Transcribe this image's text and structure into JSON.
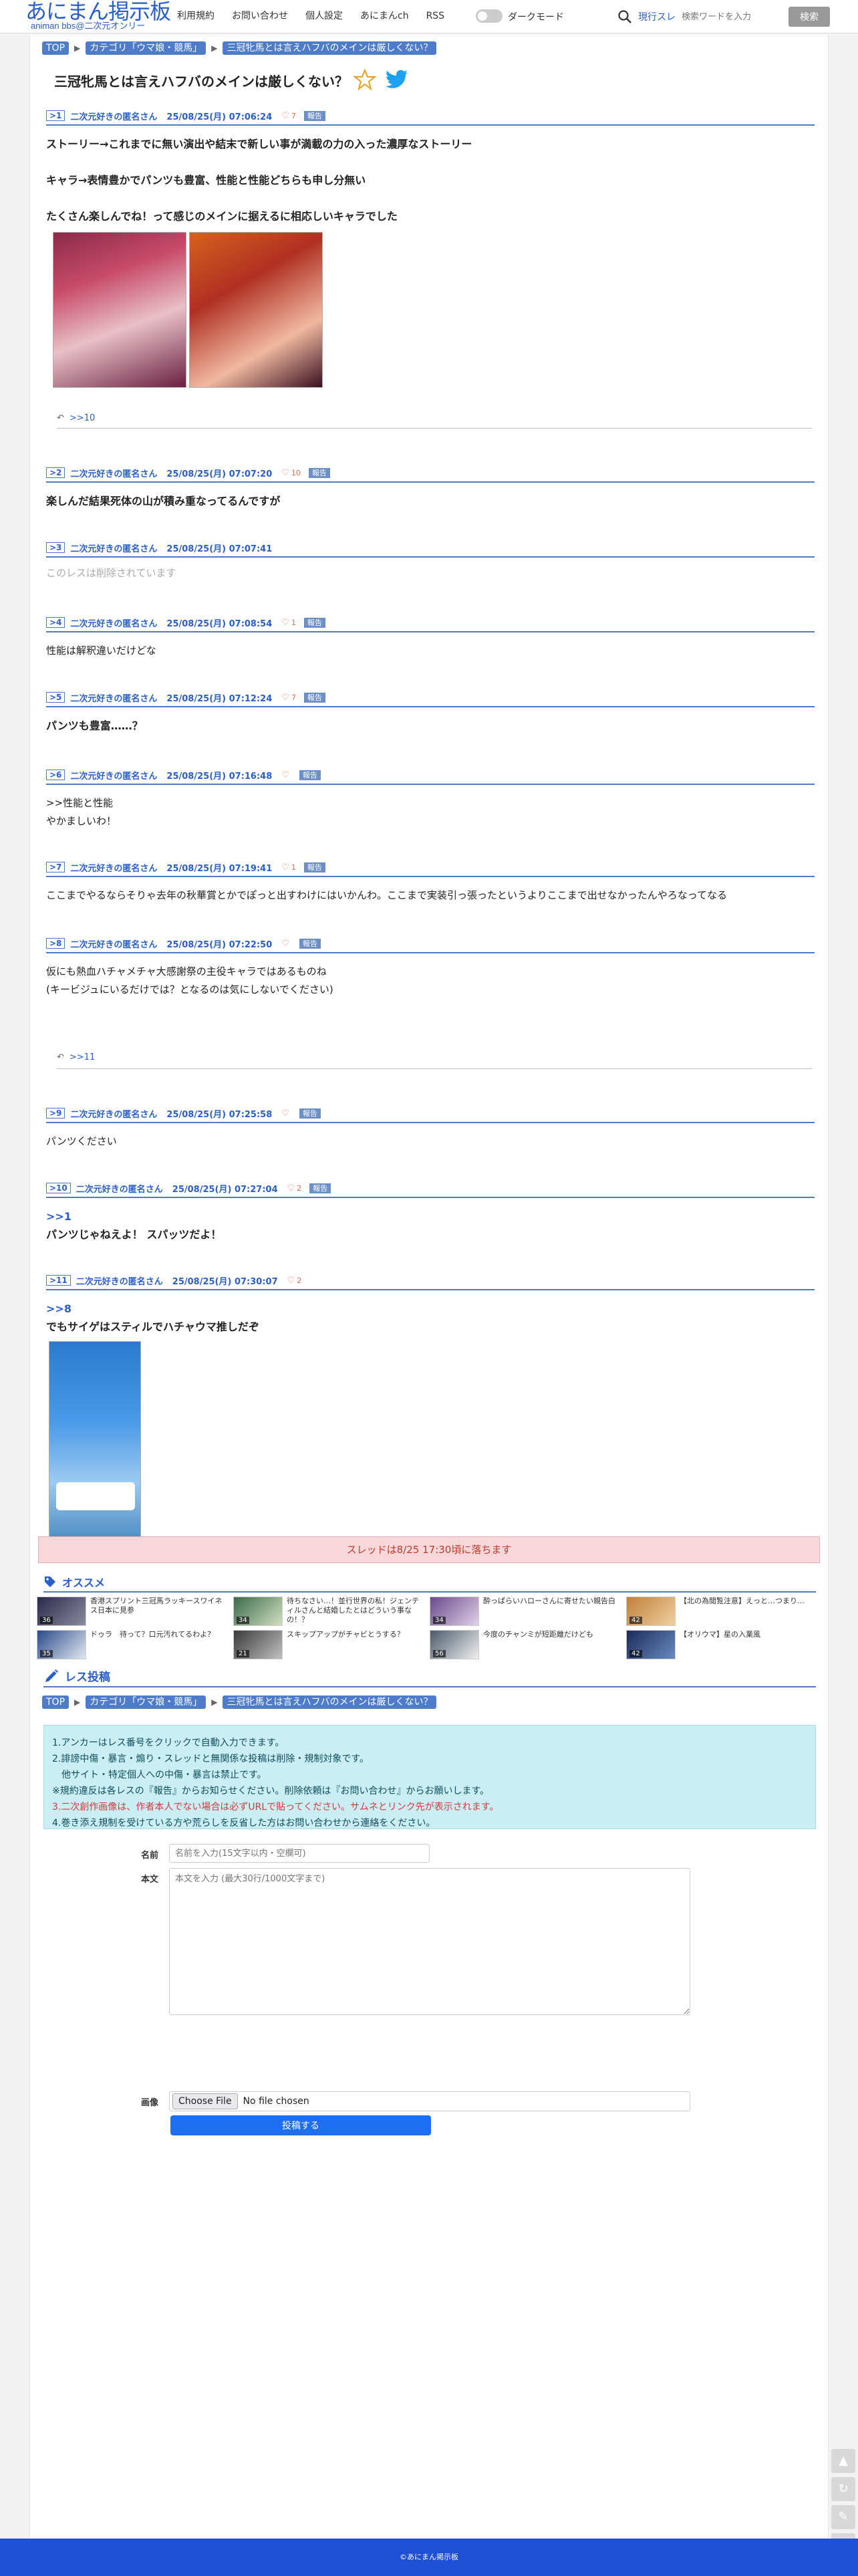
{
  "header": {
    "logo_main": "あにまん掲示板",
    "logo_sub": "animan bbs@二次元オンリー",
    "nav": [
      "利用規約",
      "お問い合わせ",
      "個人設定",
      "あにまんch",
      "RSS"
    ],
    "dark_mode_label": "ダークモード",
    "search_scope": "現行スレ",
    "search_placeholder": "検索ワードを入力",
    "search_button": "検索"
  },
  "breadcrumb": {
    "top": "TOP",
    "category": "カテゴリ「ウマ娘・競馬」",
    "thread": "三冠牝馬とは言えハフバのメインは厳しくない？"
  },
  "thread_title": "三冠牝馬とは言えハフバのメインは厳しくない？",
  "report_label": "報告",
  "posts": [
    {
      "num": ">1",
      "name": "二次元好きの匿名さん",
      "date": "25/08/25(月) 07:06:24",
      "likes": "7",
      "lines": [
        "ストーリー→これまでに無い演出や結末で新しい事が満載の力の入った濃厚なストーリー",
        "キャラ→表情豊かでパンツも豊富、性能と性能どちらも申し分無い",
        "たくさん楽しんでね！って感じのメインに据えるに相応しいキャラでした"
      ],
      "reply": ">>10"
    },
    {
      "num": ">2",
      "name": "二次元好きの匿名さん",
      "date": "25/08/25(月) 07:07:20",
      "likes": "10",
      "lines": [
        "楽しんだ結果死体の山が積み重なってるんですが"
      ]
    },
    {
      "num": ">3",
      "name": "二次元好きの匿名さん",
      "date": "25/08/25(月) 07:07:41",
      "deleted": "このレスは削除されています"
    },
    {
      "num": ">4",
      "name": "二次元好きの匿名さん",
      "date": "25/08/25(月) 07:08:54",
      "likes": "1",
      "lines": [
        "性能は解釈違いだけどな"
      ]
    },
    {
      "num": ">5",
      "name": "二次元好きの匿名さん",
      "date": "25/08/25(月) 07:12:24",
      "likes": "7",
      "lines": [
        "パンツも豊富……？"
      ]
    },
    {
      "num": ">6",
      "name": "二次元好きの匿名さん",
      "date": "25/08/25(月) 07:16:48",
      "likes": "",
      "lines": [
        ">>性能と性能",
        "やかましいわ！"
      ]
    },
    {
      "num": ">7",
      "name": "二次元好きの匿名さん",
      "date": "25/08/25(月) 07:19:41",
      "likes": "1",
      "lines": [
        "ここまでやるならそりゃ去年の秋華賞とかでぽっと出すわけにはいかんわ。ここまで実装引っ張ったというよりここまで出せなかったんやろなってなる"
      ]
    },
    {
      "num": ">8",
      "name": "二次元好きの匿名さん",
      "date": "25/08/25(月) 07:22:50",
      "likes": "",
      "lines": [
        "仮にも熱血ハチャメチャ大感謝祭の主役キャラではあるものね",
        "(キービジュにいるだけでは？となるのは気にしないでください)"
      ],
      "reply": ">>11"
    },
    {
      "num": ">9",
      "name": "二次元好きの匿名さん",
      "date": "25/08/25(月) 07:25:58",
      "likes": "",
      "lines": [
        "パンツください"
      ]
    },
    {
      "num": ">10",
      "name": "二次元好きの匿名さん",
      "date": "25/08/25(月) 07:27:04",
      "likes": "2",
      "anchor": ">>1",
      "lines": [
        "パンツじゃねえよ！ スパッツだよ！"
      ]
    },
    {
      "num": ">11",
      "name": "二次元好きの匿名さん",
      "date": "25/08/25(月) 07:30:07",
      "likes": "2",
      "anchor": ">>8",
      "lines": [
        "でもサイゲはスティルでハチャウマ推しだぞ"
      ]
    }
  ],
  "closed_notice": "スレッドは8/25 17:30頃に落ちます",
  "recommend": {
    "heading": "オススメ",
    "items": [
      {
        "title": "香港スプリント三冠馬ラッキースワイネス日本に見参",
        "count": "36"
      },
      {
        "title": "待ちなさい…！並行世界の私！ジェンティルさんと結婚したとはどういう事なの！？",
        "count": "34"
      },
      {
        "title": "酔っぱらいハローさんに寄せたい親告白",
        "count": "34"
      },
      {
        "title": "【北の為閲覧注意】えっと…つまり…",
        "count": "42"
      },
      {
        "title": "ドゥラ　待って？口元汚れてるわよ？",
        "count": "35"
      },
      {
        "title": "スキップアップがチャビとうする？",
        "count": "21"
      },
      {
        "title": "今度のチャンミが短距離だけども",
        "count": "56"
      },
      {
        "title": "【オリウマ】星の入業風",
        "count": "42"
      }
    ]
  },
  "form": {
    "heading": "レス投稿",
    "notice": [
      "1.アンカーはレス番号をクリックで自動入力できます。",
      "2.誹謗中傷・暴言・煽り・スレッドと無関係な投稿は削除・規制対象です。",
      "　他サイト・特定個人への中傷・暴言は禁止です。",
      "※規約違反は各レスの『報告』からお知らせください。削除依頼は『お問い合わせ』からお願いします。",
      "3.二次創作画像は、作者本人でない場合は必ずURLで貼ってください。サムネとリンク先が表示されます。",
      "4.巻き添え規制を受けている方や荒らしを反省した方はお問い合わせから連絡をください。"
    ],
    "name_label": "名前",
    "name_placeholder": "名前を入力(15文字以内・空欄可)",
    "body_label": "本文",
    "body_placeholder": "本文を入力 (最大30行/1000文字まで)",
    "image_label": "画像",
    "file_button": "Choose File",
    "file_status": "No file chosen",
    "submit_label": "投稿する"
  },
  "footer": "©あにまん掲示板",
  "colors": {
    "accent": "#2a5ec9",
    "footer": "#1f4fd4",
    "closed_bg": "#f8d7da",
    "notice_bg": "#cbeef5"
  }
}
